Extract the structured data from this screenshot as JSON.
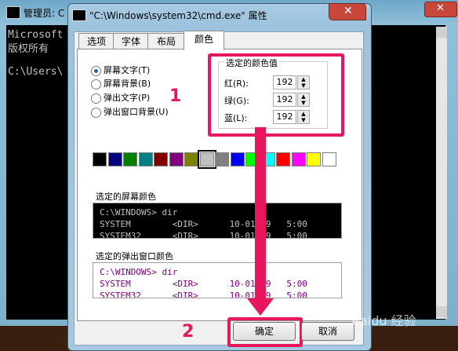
{
  "background_window": {
    "title": "管理员: C",
    "console_lines": [
      "Microsoft",
      "版权所有",
      "C:\\Users\\"
    ],
    "close_glyph": "✕"
  },
  "dialog": {
    "title": "\"C:\\Windows\\system32\\cmd.exe\" 属性",
    "close_glyph": "✕",
    "tabs": [
      {
        "label": "选项",
        "active": false
      },
      {
        "label": "字体",
        "active": false
      },
      {
        "label": "布局",
        "active": false
      },
      {
        "label": "颜色",
        "active": true
      }
    ],
    "radios": [
      {
        "label": "屏幕文字(T)",
        "checked": true
      },
      {
        "label": "屏幕背景(B)",
        "checked": false
      },
      {
        "label": "弹出文字(P)",
        "checked": false
      },
      {
        "label": "弹出窗口背景(U)",
        "checked": false
      }
    ],
    "selected_color": {
      "group_label": "选定的颜色值",
      "red_label": "红(R):",
      "red_value": "192",
      "green_label": "绿(G):",
      "green_value": "192",
      "blue_label": "蓝(L):",
      "blue_value": "192"
    },
    "palette": [
      "#000000",
      "#000080",
      "#008000",
      "#008080",
      "#800000",
      "#800080",
      "#808000",
      "#c0c0c0",
      "#808080",
      "#0000ff",
      "#00ff00",
      "#00ffff",
      "#ff0000",
      "#ff00ff",
      "#ffff00",
      "#ffffff"
    ],
    "screen_preview": {
      "label": "选定的屏幕颜色",
      "lines": [
        "C:\\WINDOWS> dir",
        "SYSTEM        <DIR>      10-01-99   5:00",
        "SYSTEM32      <DIR>      10-01-99   5:00"
      ],
      "fg": "#c0c0c0",
      "bg": "#000000"
    },
    "popup_preview": {
      "label": "选定的弹出窗口颜色",
      "lines": [
        "C:\\WINDOWS> dir",
        "SYSTEM        <DIR>      10-01-99   5:00",
        "SYSTEM32      <DIR>      10-01-99   5:00"
      ],
      "fg": "#800080",
      "bg": "#ffffff"
    },
    "ok_label": "确定",
    "cancel_label": "取消"
  },
  "annotations": {
    "step1": "1",
    "step2": "2",
    "accent": "#e8175d"
  },
  "watermark": "Baidu 经验"
}
